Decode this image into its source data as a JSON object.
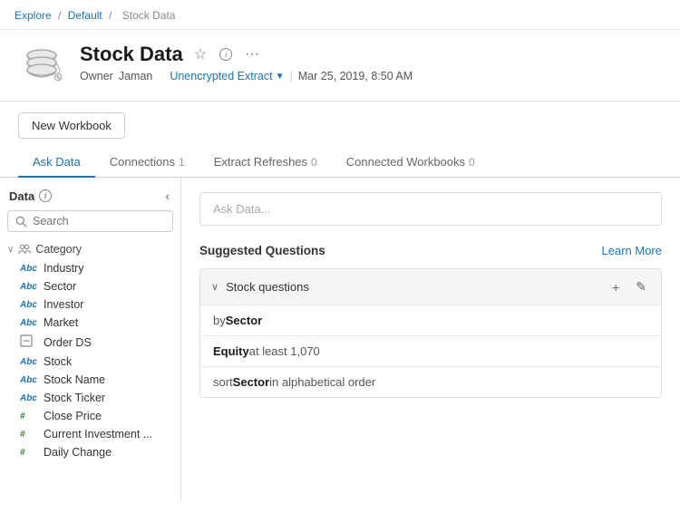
{
  "breadcrumb": {
    "explore": "Explore",
    "separator1": "/",
    "default": "Default",
    "separator2": "/",
    "current": "Stock Data"
  },
  "header": {
    "title": "Stock Data",
    "owner_label": "Owner",
    "owner_name": "Jaman",
    "extract_text": "Unencrypted Extract",
    "extract_arrow": "▼",
    "date": "Mar 25, 2019, 8:50 AM",
    "star_icon": "☆",
    "info_icon": "i",
    "more_icon": "···"
  },
  "toolbar": {
    "new_workbook_label": "New Workbook"
  },
  "tabs": [
    {
      "id": "ask-data",
      "label": "Ask Data",
      "badge": "",
      "active": true
    },
    {
      "id": "connections",
      "label": "Connections",
      "badge": "1",
      "active": false
    },
    {
      "id": "extract-refreshes",
      "label": "Extract Refreshes",
      "badge": "0",
      "active": false
    },
    {
      "id": "connected-workbooks",
      "label": "Connected Workbooks",
      "badge": "0",
      "active": false
    }
  ],
  "sidebar": {
    "title": "Data",
    "collapse_icon": "‹",
    "search_placeholder": "Search",
    "tree": {
      "group_chevron": "∨",
      "group_icon": "👥",
      "group_label": "Category",
      "items": [
        {
          "type": "Abc",
          "label": "Industry",
          "is_number": false
        },
        {
          "type": "Abc",
          "label": "Sector",
          "is_number": false
        },
        {
          "type": "Abc",
          "label": "Investor",
          "is_number": false
        },
        {
          "type": "Abc",
          "label": "Market",
          "is_number": false
        },
        {
          "type": "⊟",
          "label": "Order DS",
          "is_number": false
        },
        {
          "type": "Abc",
          "label": "Stock",
          "is_number": false
        },
        {
          "type": "Abc",
          "label": "Stock Name",
          "is_number": false
        },
        {
          "type": "Abc",
          "label": "Stock Ticker",
          "is_number": false
        },
        {
          "type": "#",
          "label": "Close Price",
          "is_number": true
        },
        {
          "type": "#",
          "label": "Current Investment ...",
          "is_number": true
        },
        {
          "type": "#",
          "label": "Daily Change",
          "is_number": true
        }
      ]
    }
  },
  "content": {
    "ask_data_placeholder": "Ask Data...",
    "suggested_title": "Suggested Questions",
    "learn_more_label": "Learn More",
    "accordion": {
      "label": "Stock questions",
      "chevron": "∨",
      "add_icon": "+",
      "edit_icon": "✎",
      "questions": [
        {
          "parts": [
            {
              "text": "by ",
              "bold": false
            },
            {
              "text": "Sector",
              "bold": true
            }
          ]
        },
        {
          "parts": [
            {
              "text": "Equity",
              "bold": true
            },
            {
              "text": " at least 1,070",
              "bold": false
            }
          ]
        },
        {
          "parts": [
            {
              "text": "sort ",
              "bold": false
            },
            {
              "text": "Sector",
              "bold": true
            },
            {
              "text": " in alphabetical order",
              "bold": false
            }
          ]
        }
      ]
    }
  }
}
